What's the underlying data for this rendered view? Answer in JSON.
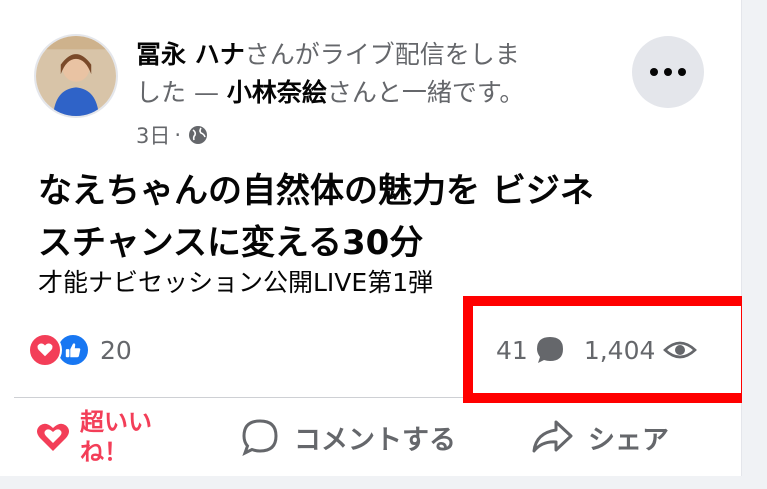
{
  "post": {
    "author": "冨永 ハナ",
    "action_text_1": "さんがライブ配信をしま",
    "action_text_2": "した — ",
    "with_user": "小林奈絵",
    "with_suffix": "さんと一緒です。",
    "timestamp": "3日",
    "separator": "·",
    "privacy_icon": "globe-icon",
    "title_line_1": "なえちゃんの自然体の魅力を ビジネ",
    "title_line_2": "スチャンスに変える30分",
    "subtitle": "才能ナビセッション公開LIVE第1弾"
  },
  "engagement": {
    "reaction_icons": [
      "love-icon",
      "like-icon"
    ],
    "reaction_count": "20",
    "comment_count": "41",
    "view_count": "1,404"
  },
  "actions": {
    "love_label_1": "超いい",
    "love_label_2": "ね！",
    "comment_label": "コメントする",
    "share_label": "シェア"
  },
  "colors": {
    "love": "#f33e58",
    "like": "#1877f2",
    "secondary_text": "#65676b",
    "highlight": "#ff0000"
  }
}
